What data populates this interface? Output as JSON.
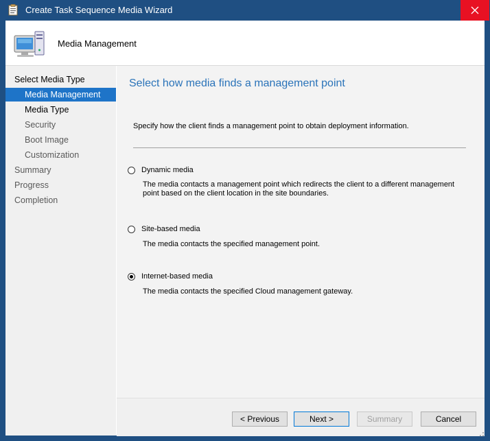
{
  "window": {
    "title": "Create Task Sequence Media Wizard",
    "close_icon": "close-icon"
  },
  "header": {
    "title": "Media Management",
    "icon": "computer-icon"
  },
  "nav": {
    "items": [
      {
        "label": "Select Media Type",
        "level": "top",
        "state": "normal"
      },
      {
        "label": "Media Management",
        "level": "sub",
        "state": "selected"
      },
      {
        "label": "Media Type",
        "level": "sub",
        "state": "normal"
      },
      {
        "label": "Security",
        "level": "sub",
        "state": "dim"
      },
      {
        "label": "Boot Image",
        "level": "sub",
        "state": "dim"
      },
      {
        "label": "Customization",
        "level": "sub",
        "state": "dim"
      },
      {
        "label": "Summary",
        "level": "top",
        "state": "dim"
      },
      {
        "label": "Progress",
        "level": "top",
        "state": "dim"
      },
      {
        "label": "Completion",
        "level": "top",
        "state": "dim"
      }
    ]
  },
  "main": {
    "heading": "Select how media finds a management point",
    "instruction": "Specify how the client finds a management point to obtain deployment information.",
    "options": [
      {
        "label": "Dynamic media",
        "description": "The media contacts a management point which redirects the client to a different management point based on the client location in the site boundaries.",
        "checked": false
      },
      {
        "label": "Site-based media",
        "description": "The media contacts the specified management point.",
        "checked": false
      },
      {
        "label": "Internet-based media",
        "description": "The media contacts the specified Cloud management gateway.",
        "checked": true
      }
    ]
  },
  "footer": {
    "previous_label": "< Previous",
    "next_label": "Next >",
    "summary_label": "Summary",
    "cancel_label": "Cancel"
  },
  "colors": {
    "titlebar": "#1f4f82",
    "close_button": "#e81123",
    "selected_nav": "#1e74c8",
    "heading": "#2a73b9"
  }
}
